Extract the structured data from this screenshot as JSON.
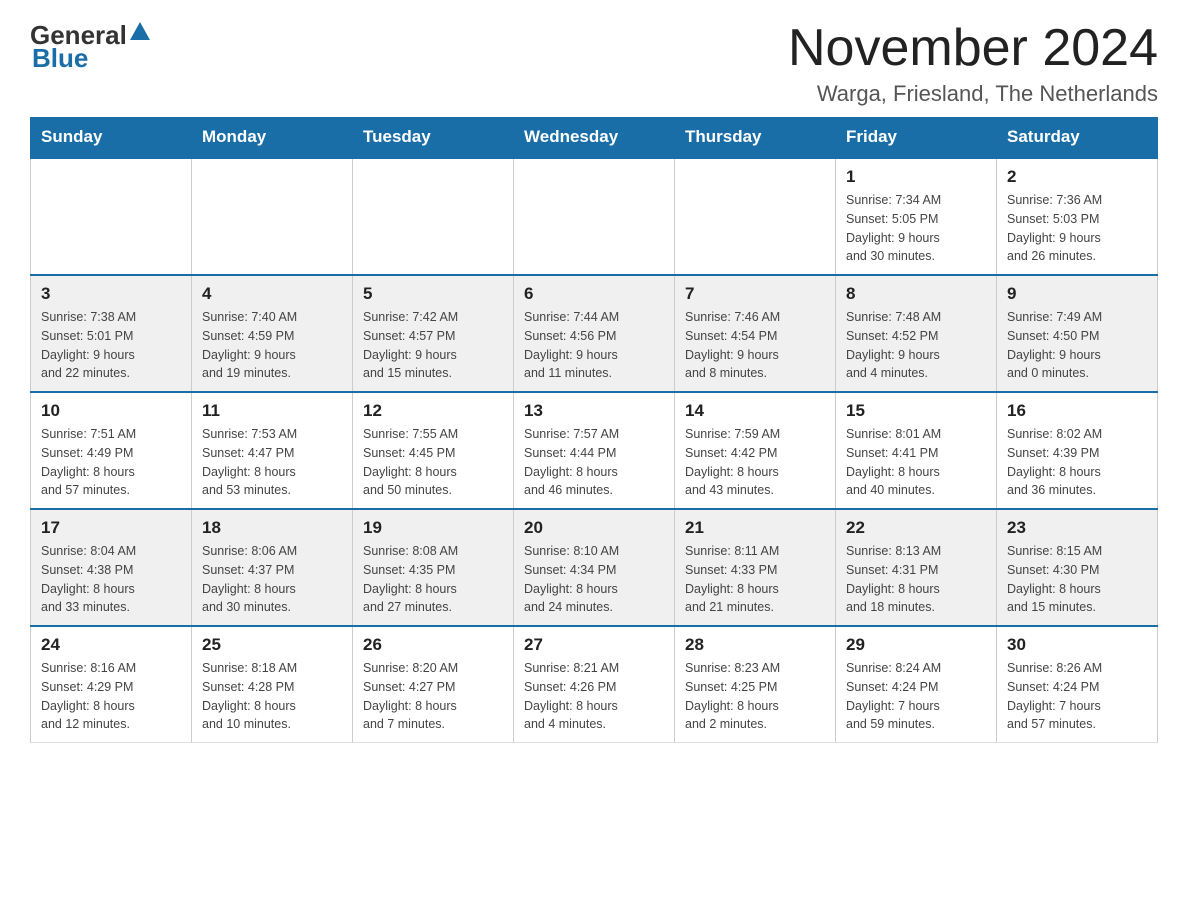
{
  "logo": {
    "text_general": "General",
    "text_blue": "Blue"
  },
  "header": {
    "month_title": "November 2024",
    "location": "Warga, Friesland, The Netherlands"
  },
  "days_of_week": [
    "Sunday",
    "Monday",
    "Tuesday",
    "Wednesday",
    "Thursday",
    "Friday",
    "Saturday"
  ],
  "weeks": [
    [
      {
        "day": "",
        "info": ""
      },
      {
        "day": "",
        "info": ""
      },
      {
        "day": "",
        "info": ""
      },
      {
        "day": "",
        "info": ""
      },
      {
        "day": "",
        "info": ""
      },
      {
        "day": "1",
        "info": "Sunrise: 7:34 AM\nSunset: 5:05 PM\nDaylight: 9 hours\nand 30 minutes."
      },
      {
        "day": "2",
        "info": "Sunrise: 7:36 AM\nSunset: 5:03 PM\nDaylight: 9 hours\nand 26 minutes."
      }
    ],
    [
      {
        "day": "3",
        "info": "Sunrise: 7:38 AM\nSunset: 5:01 PM\nDaylight: 9 hours\nand 22 minutes."
      },
      {
        "day": "4",
        "info": "Sunrise: 7:40 AM\nSunset: 4:59 PM\nDaylight: 9 hours\nand 19 minutes."
      },
      {
        "day": "5",
        "info": "Sunrise: 7:42 AM\nSunset: 4:57 PM\nDaylight: 9 hours\nand 15 minutes."
      },
      {
        "day": "6",
        "info": "Sunrise: 7:44 AM\nSunset: 4:56 PM\nDaylight: 9 hours\nand 11 minutes."
      },
      {
        "day": "7",
        "info": "Sunrise: 7:46 AM\nSunset: 4:54 PM\nDaylight: 9 hours\nand 8 minutes."
      },
      {
        "day": "8",
        "info": "Sunrise: 7:48 AM\nSunset: 4:52 PM\nDaylight: 9 hours\nand 4 minutes."
      },
      {
        "day": "9",
        "info": "Sunrise: 7:49 AM\nSunset: 4:50 PM\nDaylight: 9 hours\nand 0 minutes."
      }
    ],
    [
      {
        "day": "10",
        "info": "Sunrise: 7:51 AM\nSunset: 4:49 PM\nDaylight: 8 hours\nand 57 minutes."
      },
      {
        "day": "11",
        "info": "Sunrise: 7:53 AM\nSunset: 4:47 PM\nDaylight: 8 hours\nand 53 minutes."
      },
      {
        "day": "12",
        "info": "Sunrise: 7:55 AM\nSunset: 4:45 PM\nDaylight: 8 hours\nand 50 minutes."
      },
      {
        "day": "13",
        "info": "Sunrise: 7:57 AM\nSunset: 4:44 PM\nDaylight: 8 hours\nand 46 minutes."
      },
      {
        "day": "14",
        "info": "Sunrise: 7:59 AM\nSunset: 4:42 PM\nDaylight: 8 hours\nand 43 minutes."
      },
      {
        "day": "15",
        "info": "Sunrise: 8:01 AM\nSunset: 4:41 PM\nDaylight: 8 hours\nand 40 minutes."
      },
      {
        "day": "16",
        "info": "Sunrise: 8:02 AM\nSunset: 4:39 PM\nDaylight: 8 hours\nand 36 minutes."
      }
    ],
    [
      {
        "day": "17",
        "info": "Sunrise: 8:04 AM\nSunset: 4:38 PM\nDaylight: 8 hours\nand 33 minutes."
      },
      {
        "day": "18",
        "info": "Sunrise: 8:06 AM\nSunset: 4:37 PM\nDaylight: 8 hours\nand 30 minutes."
      },
      {
        "day": "19",
        "info": "Sunrise: 8:08 AM\nSunset: 4:35 PM\nDaylight: 8 hours\nand 27 minutes."
      },
      {
        "day": "20",
        "info": "Sunrise: 8:10 AM\nSunset: 4:34 PM\nDaylight: 8 hours\nand 24 minutes."
      },
      {
        "day": "21",
        "info": "Sunrise: 8:11 AM\nSunset: 4:33 PM\nDaylight: 8 hours\nand 21 minutes."
      },
      {
        "day": "22",
        "info": "Sunrise: 8:13 AM\nSunset: 4:31 PM\nDaylight: 8 hours\nand 18 minutes."
      },
      {
        "day": "23",
        "info": "Sunrise: 8:15 AM\nSunset: 4:30 PM\nDaylight: 8 hours\nand 15 minutes."
      }
    ],
    [
      {
        "day": "24",
        "info": "Sunrise: 8:16 AM\nSunset: 4:29 PM\nDaylight: 8 hours\nand 12 minutes."
      },
      {
        "day": "25",
        "info": "Sunrise: 8:18 AM\nSunset: 4:28 PM\nDaylight: 8 hours\nand 10 minutes."
      },
      {
        "day": "26",
        "info": "Sunrise: 8:20 AM\nSunset: 4:27 PM\nDaylight: 8 hours\nand 7 minutes."
      },
      {
        "day": "27",
        "info": "Sunrise: 8:21 AM\nSunset: 4:26 PM\nDaylight: 8 hours\nand 4 minutes."
      },
      {
        "day": "28",
        "info": "Sunrise: 8:23 AM\nSunset: 4:25 PM\nDaylight: 8 hours\nand 2 minutes."
      },
      {
        "day": "29",
        "info": "Sunrise: 8:24 AM\nSunset: 4:24 PM\nDaylight: 7 hours\nand 59 minutes."
      },
      {
        "day": "30",
        "info": "Sunrise: 8:26 AM\nSunset: 4:24 PM\nDaylight: 7 hours\nand 57 minutes."
      }
    ]
  ]
}
